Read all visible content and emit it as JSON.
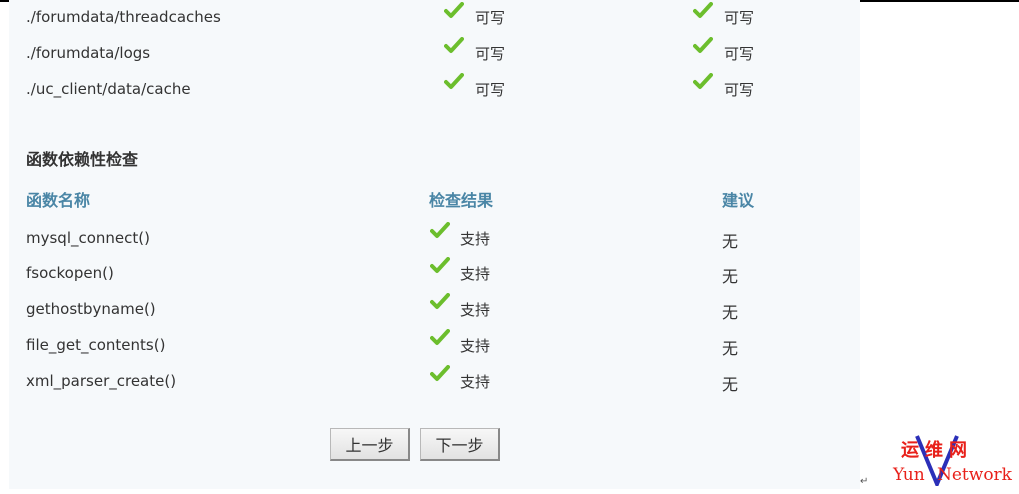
{
  "dirs": [
    {
      "path": "./forumdata/threadcaches",
      "current": "可写",
      "required": "可写"
    },
    {
      "path": "./forumdata/logs",
      "current": "可写",
      "required": "可写"
    },
    {
      "path": "./uc_client/data/cache",
      "current": "可写",
      "required": "可写"
    }
  ],
  "func_section": {
    "title": "函数依赖性检查",
    "headers": {
      "name": "函数名称",
      "result": "检查结果",
      "advice": "建议"
    },
    "rows": [
      {
        "name": "mysql_connect()",
        "result": "支持",
        "advice": "无"
      },
      {
        "name": "fsockopen()",
        "result": "支持",
        "advice": "无"
      },
      {
        "name": "gethostbyname()",
        "result": "支持",
        "advice": "无"
      },
      {
        "name": "file_get_contents()",
        "result": "支持",
        "advice": "无"
      },
      {
        "name": "xml_parser_create()",
        "result": "支持",
        "advice": "无"
      }
    ]
  },
  "buttons": {
    "prev": "上一步",
    "next": "下一步"
  },
  "logo": {
    "cn": "运维网",
    "yun": "Yun",
    "network": "Network"
  },
  "colors": {
    "header": "#4a86a6",
    "check": "#6cbe2d",
    "logo": "#e8201a"
  },
  "icons": {
    "check": "check-icon"
  }
}
